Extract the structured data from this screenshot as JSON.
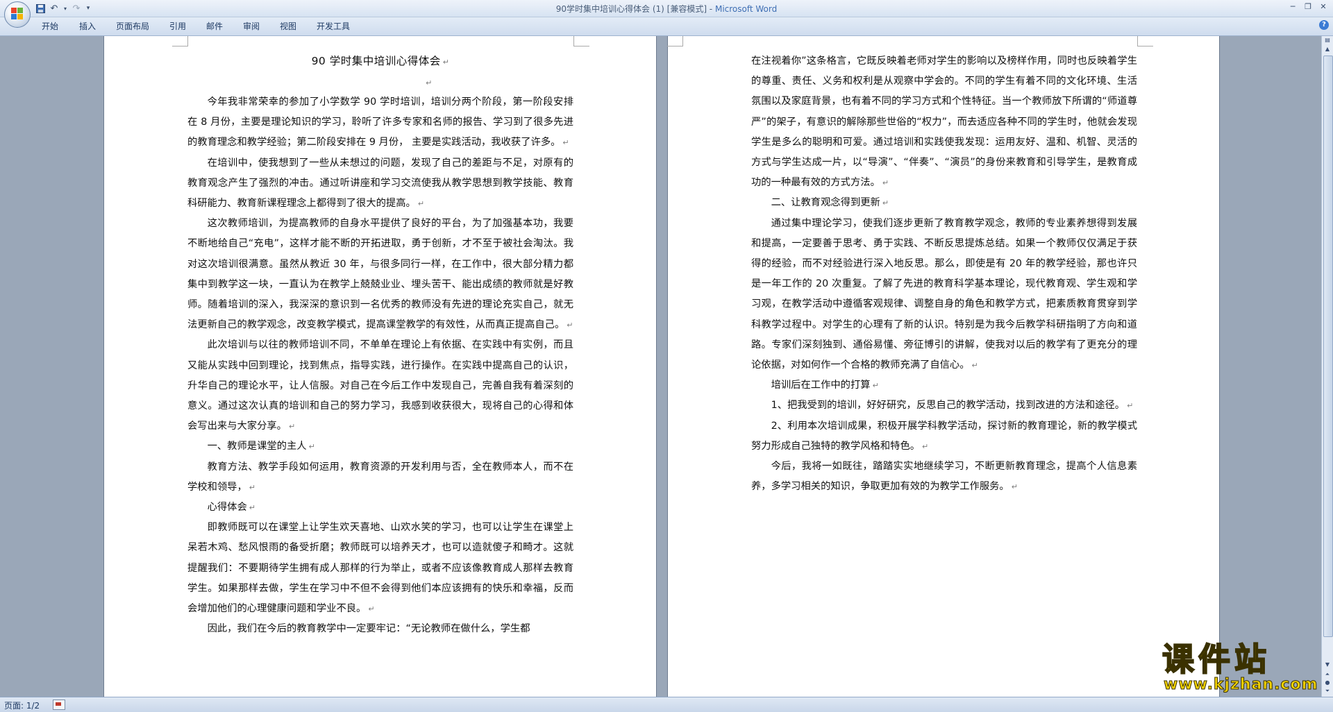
{
  "window": {
    "title_doc": "90学时集中培训心得体会 (1) [兼容模式] - ",
    "title_app": "Microsoft Word"
  },
  "ribbon": {
    "tabs": [
      "开始",
      "插入",
      "页面布局",
      "引用",
      "邮件",
      "审阅",
      "视图",
      "开发工具"
    ]
  },
  "document": {
    "title": "90 学时集中培训心得体会",
    "page1": [
      {
        "text": "今年我非常荣幸的参加了小学数学 90 学时培训，培训分两个阶段，第一阶段安排在 8 月份，主要是理论知识的学习，聆听了许多专家和名师的报告、学习到了很多先进的教育理念和教学经验；第二阶段安排在 9 月份， 主要是实践活动，我收获了许多。",
        "indent": true
      },
      {
        "text": "在培训中，使我想到了一些从未想过的问题，发现了自己的差距与不足，对原有的教育观念产生了强烈的冲击。通过听讲座和学习交流使我从教学思想到教学技能、教育科研能力、教育新课程理念上都得到了很大的提高。",
        "indent": true
      },
      {
        "text": "这次教师培训，为提高教师的自身水平提供了良好的平台，为了加强基本功，我要不断地给自己“充电”，这样才能不断的开拓进取，勇于创新，才不至于被社会淘汰。我对这次培训很满意。虽然从教近 30 年，与很多同行一样，在工作中，很大部分精力都集中到教学这一块，一直认为在教学上兢兢业业、埋头苦干、能出成绩的教师就是好教师。随着培训的深入，我深深的意识到一名优秀的教师没有先进的理论充实自己，就无法更新自己的教学观念，改变教学模式，提高课堂教学的有效性，从而真正提高自己。",
        "indent": true
      },
      {
        "text": "此次培训与以往的教师培训不同，不单单在理论上有依据、在实践中有实例，而且又能从实践中回到理论，找到焦点，指导实践，进行操作。在实践中提高自己的认识，升华自己的理论水平，让人信服。对自己在今后工作中发现自己，完善自我有着深刻的意义。通过这次认真的培训和自己的努力学习，我感到收获很大，现将自己的心得和体会写出来与大家分享。",
        "indent": true
      },
      {
        "text": "一、教师是课堂的主人",
        "indent": true
      },
      {
        "text": "教育方法、教学手段如何运用，教育资源的开发利用与否，全在教师本人，而不在学校和领导，",
        "indent": true
      },
      {
        "text": "心得体会",
        "indent": true
      },
      {
        "text": "即教师既可以在课堂上让学生欢天喜地、山欢水笑的学习，也可以让学生在课堂上呆若木鸡、愁风恨雨的备受折磨；教师既可以培养天才，也可以造就傻子和畸才。这就提醒我们：不要期待学生拥有成人那样的行为举止，或者不应该像教育成人那样去教育学生。如果那样去做，学生在学习中不但不会得到他们本应该拥有的快乐和幸福，反而会增加他们的心理健康问题和学业不良。",
        "indent": true
      },
      {
        "text": "因此，我们在今后的教育教学中一定要牢记：“无论教师在做什么，学生都",
        "indent": true,
        "no_mark": true
      }
    ],
    "page2": [
      {
        "text": "在注视着你”这条格言，它既反映着老师对学生的影响以及榜样作用，同时也反映着学生的尊重、责任、义务和权利是从观察中学会的。不同的学生有着不同的文化环境、生活氛围以及家庭背景，也有着不同的学习方式和个性特征。当一个教师放下所谓的“师道尊严”的架子，有意识的解除那些世俗的“权力”，而去适应各种不同的学生时，他就会发现学生是多么的聪明和可爱。通过培训和实践使我发现：运用友好、温和、机智、灵活的方式与学生达成一片，以“导演”、“伴奏”、“演员”的身份来教育和引导学生，是教育成功的一种最有效的方式方法。",
        "indent": false
      },
      {
        "text": "二、让教育观念得到更新",
        "indent": true
      },
      {
        "text": "通过集中理论学习，使我们逐步更新了教育教学观念，教师的专业素养想得到发展和提高，一定要善于思考、勇于实践、不断反思提炼总结。如果一个教师仅仅满足于获得的经验，而不对经验进行深入地反思。那么，即使是有 20 年的教学经验，那也许只是一年工作的 20 次重复。了解了先进的教育科学基本理论，现代教育观、学生观和学习观，在教学活动中遵循客观规律、调整自身的角色和教学方式，把素质教育贯穿到学科教学过程中。对学生的心理有了新的认识。特别是为我今后教学科研指明了方向和道路。专家们深刻独到、通俗易懂、旁征博引的讲解，使我对以后的教学有了更充分的理论依据，对如何作一个合格的教师充满了自信心。",
        "indent": true
      },
      {
        "text": "培训后在工作中的打算",
        "indent": true
      },
      {
        "text": "1、把我受到的培训，好好研究，反思自己的教学活动，找到改进的方法和途径。",
        "indent": true
      },
      {
        "text": "2、利用本次培训成果，积极开展学科教学活动，探讨新的教育理论，新的教学模式努力形成自己独特的教学风格和特色。",
        "indent": true
      },
      {
        "text": "今后，我将一如既往，踏踏实实地继续学习，不断更新教育理念，提高个人信息素养，多学习相关的知识，争取更加有效的为教学工作服务。",
        "indent": true
      }
    ]
  },
  "statusbar": {
    "page_indicator": "页面: 1/2"
  },
  "watermark": {
    "cn": "课件站",
    "url": "www.kjzhan.com"
  },
  "colors": {
    "accent": "#3f6fb4",
    "background": "#9aa7b8",
    "watermark": "#f2d200"
  }
}
